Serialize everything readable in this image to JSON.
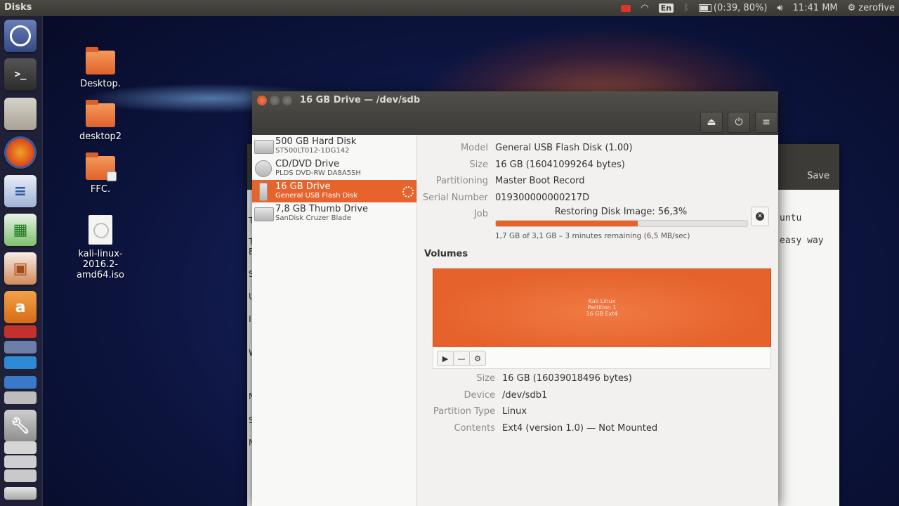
{
  "panel": {
    "app_title": "Disks",
    "battery_text": "(0:39, 80%)",
    "lang": "En",
    "time": "11:41 MM",
    "user": "zerofive"
  },
  "desktop": {
    "icons": [
      {
        "label": "Desktop."
      },
      {
        "label": "desktop2"
      },
      {
        "label": "FFC."
      },
      {
        "label": "kali-linux-2016.2-amd64.iso"
      }
    ]
  },
  "background_window": {
    "save_label": "Save",
    "snippet1": "untu",
    "snippet2": "easy way",
    "letters": [
      "T",
      "E",
      "T",
      "S",
      "U",
      "I",
      "W",
      "N",
      "S",
      "N"
    ]
  },
  "window": {
    "title": "16 GB Drive — /dev/sdb",
    "drives": [
      {
        "name": "500 GB Hard Disk",
        "sub": "ST500LT012-1DG142"
      },
      {
        "name": "CD/DVD Drive",
        "sub": "PLDS   DVD-RW DA8A5SH"
      },
      {
        "name": "16 GB Drive",
        "sub": "General USB Flash Disk"
      },
      {
        "name": "7,8 GB Thumb Drive",
        "sub": "SanDisk Cruzer Blade"
      }
    ],
    "drive_props": {
      "model_label": "Model",
      "model": "General USB Flash Disk (1.00)",
      "size_label": "Size",
      "size": "16 GB (16041099264 bytes)",
      "partitioning_label": "Partitioning",
      "partitioning": "Master Boot Record",
      "serial_label": "Serial Number",
      "serial": "019300000000217D",
      "job_label": "Job",
      "job_text": "Restoring Disk Image: 56,3%",
      "job_progress": 0.563,
      "job_detail": "1,7 GB of 3,1 GB – 3 minutes remaining (6,5 MB/sec)"
    },
    "volumes_heading": "Volumes",
    "volume": {
      "line1": "Kali Linux",
      "line2": "Partition 1",
      "line3": "16 GB Ext4"
    },
    "volume_props": {
      "size_label": "Size",
      "size": "16 GB (16039018496 bytes)",
      "device_label": "Device",
      "device": "/dev/sdb1",
      "ptype_label": "Partition Type",
      "ptype": "Linux",
      "contents_label": "Contents",
      "contents": "Ext4 (version 1.0) — Not Mounted"
    }
  },
  "colors": {
    "accent": "#e8632c",
    "panel": "#3c3b37"
  }
}
